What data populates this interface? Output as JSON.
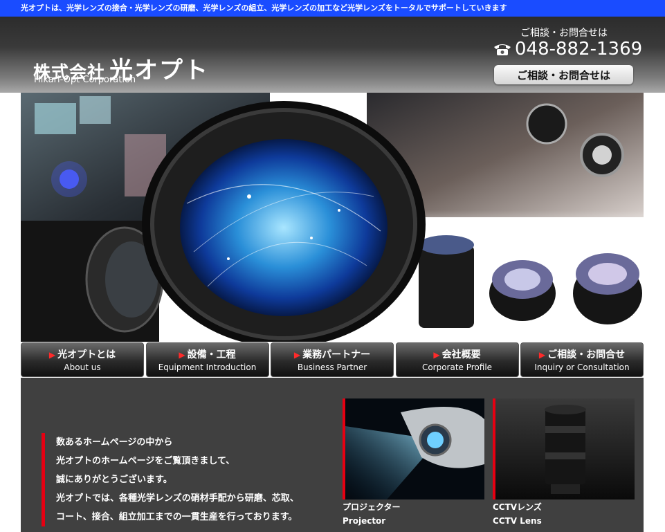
{
  "topbar": {
    "text": "光オプトは、光学レンズの接合・光学レンズの研磨、光学レンズの組立、光学レンズの加工など光学レンズをトータルでサポートしていきます"
  },
  "header": {
    "company_prefix": "株式会社",
    "company_name": "光オプト",
    "company_en": "Hikari-Opt Corporation",
    "contact_label": "ご相談・お問合せは",
    "phone": "048-882-1369",
    "contact_button": "ご相談・お問合せは"
  },
  "nav": [
    {
      "ja": "光オプトとは",
      "en": "About us"
    },
    {
      "ja": "設備・工程",
      "en": "Equipment Introduction"
    },
    {
      "ja": "業務パートナー",
      "en": "Business Partner"
    },
    {
      "ja": "会社概要",
      "en": "Corporate Profile"
    },
    {
      "ja": "ご相談・お問合せ",
      "en": "Inquiry or Consultation"
    }
  ],
  "intro": {
    "lines": [
      "数あるホームページの中から",
      "光オプトのホームページをご覧頂きまして、",
      "誠にありがとうございます。",
      "光オプトでは、各種光学レンズの硝材手配から研磨、芯取、",
      "コート、接合、組立加工までの一貫生産を行っております。"
    ]
  },
  "products": [
    {
      "ja": "プロジェクター",
      "en": "Projector"
    },
    {
      "ja": "CCTVレンズ",
      "en": "CCTV Lens"
    }
  ],
  "colors": {
    "topbar": "#1a4cff",
    "accent_red": "#e60012",
    "content_bg": "#404040"
  }
}
